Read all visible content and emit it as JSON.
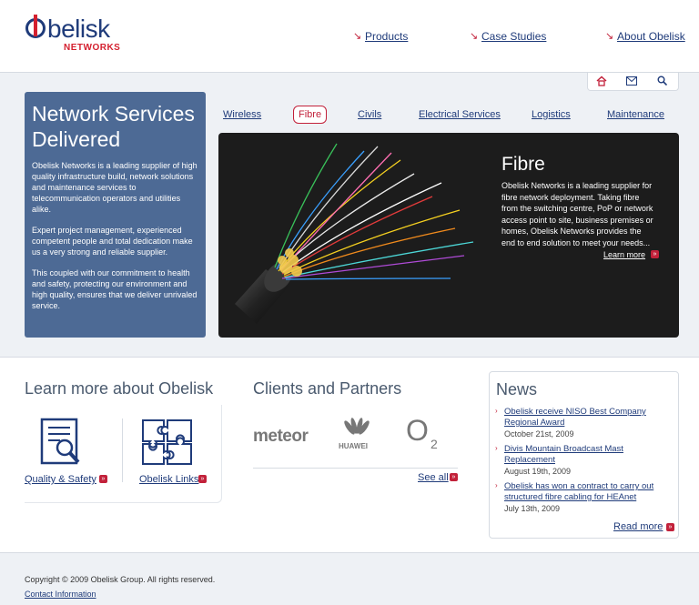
{
  "logo": {
    "word": "belisk",
    "sub": "NETWORKS"
  },
  "topnav": [
    {
      "label": "Products"
    },
    {
      "label": "Case Studies"
    },
    {
      "label": "About Obelisk"
    }
  ],
  "intro": {
    "title": "Network Services Delivered",
    "paragraphs": [
      "Obelisk Networks is a leading supplier of high quality infrastructure build, network solutions and maintenance services to telecommunication operators and utilities alike.",
      "Expert project management, experienced competent people and total dedication make us a very strong and reliable supplier.",
      "This coupled with our commitment to health and safety, protecting our environment and high quality, ensures that we deliver unrivaled service."
    ]
  },
  "tabs": [
    "Wireless",
    "Fibre",
    "Civils",
    "Electrical Services",
    "Logistics",
    "Maintenance"
  ],
  "feature": {
    "title": "Fibre",
    "text": "Obelisk Networks is a leading supplier for fibre network deployment. Taking fibre from the switching centre, PoP or network access point to site, business premises or homes, Obelisk Networks provides the end to end solution to meet your needs...",
    "more": "Learn more"
  },
  "learn": {
    "title": "Learn more about Obelisk",
    "quality": "Quality & Safety",
    "links": "Obelisk Links"
  },
  "clients": {
    "title": "Clients and Partners",
    "meteor": "meteor",
    "huawei": "HUAWEI",
    "o2": "O",
    "o2_sub": "2",
    "see_all": "See all"
  },
  "news": {
    "title": "News",
    "items": [
      {
        "title": "Obelisk receive NISO Best Company Regional Award",
        "date": "October 21st, 2009"
      },
      {
        "title": "Divis Mountain Broadcast Mast Replacement",
        "date": "August 19th, 2009"
      },
      {
        "title": "Obelisk has won a contract to carry out structured fibre cabling for HEAnet",
        "date": "July 13th, 2009"
      }
    ],
    "read_more": "Read more"
  },
  "footer": {
    "copyright": "Copyright © 2009 Obelisk Group. All rights reserved.",
    "contact": "Contact Information"
  },
  "colors": {
    "brand_blue": "#1f3b7a",
    "brand_red": "#c2213a",
    "panel_blue": "#4d6a95"
  },
  "icons": [
    "home-icon",
    "mail-icon",
    "search-icon",
    "document-search-icon",
    "puzzle-icon",
    "fibre-optic-cable-image"
  ]
}
